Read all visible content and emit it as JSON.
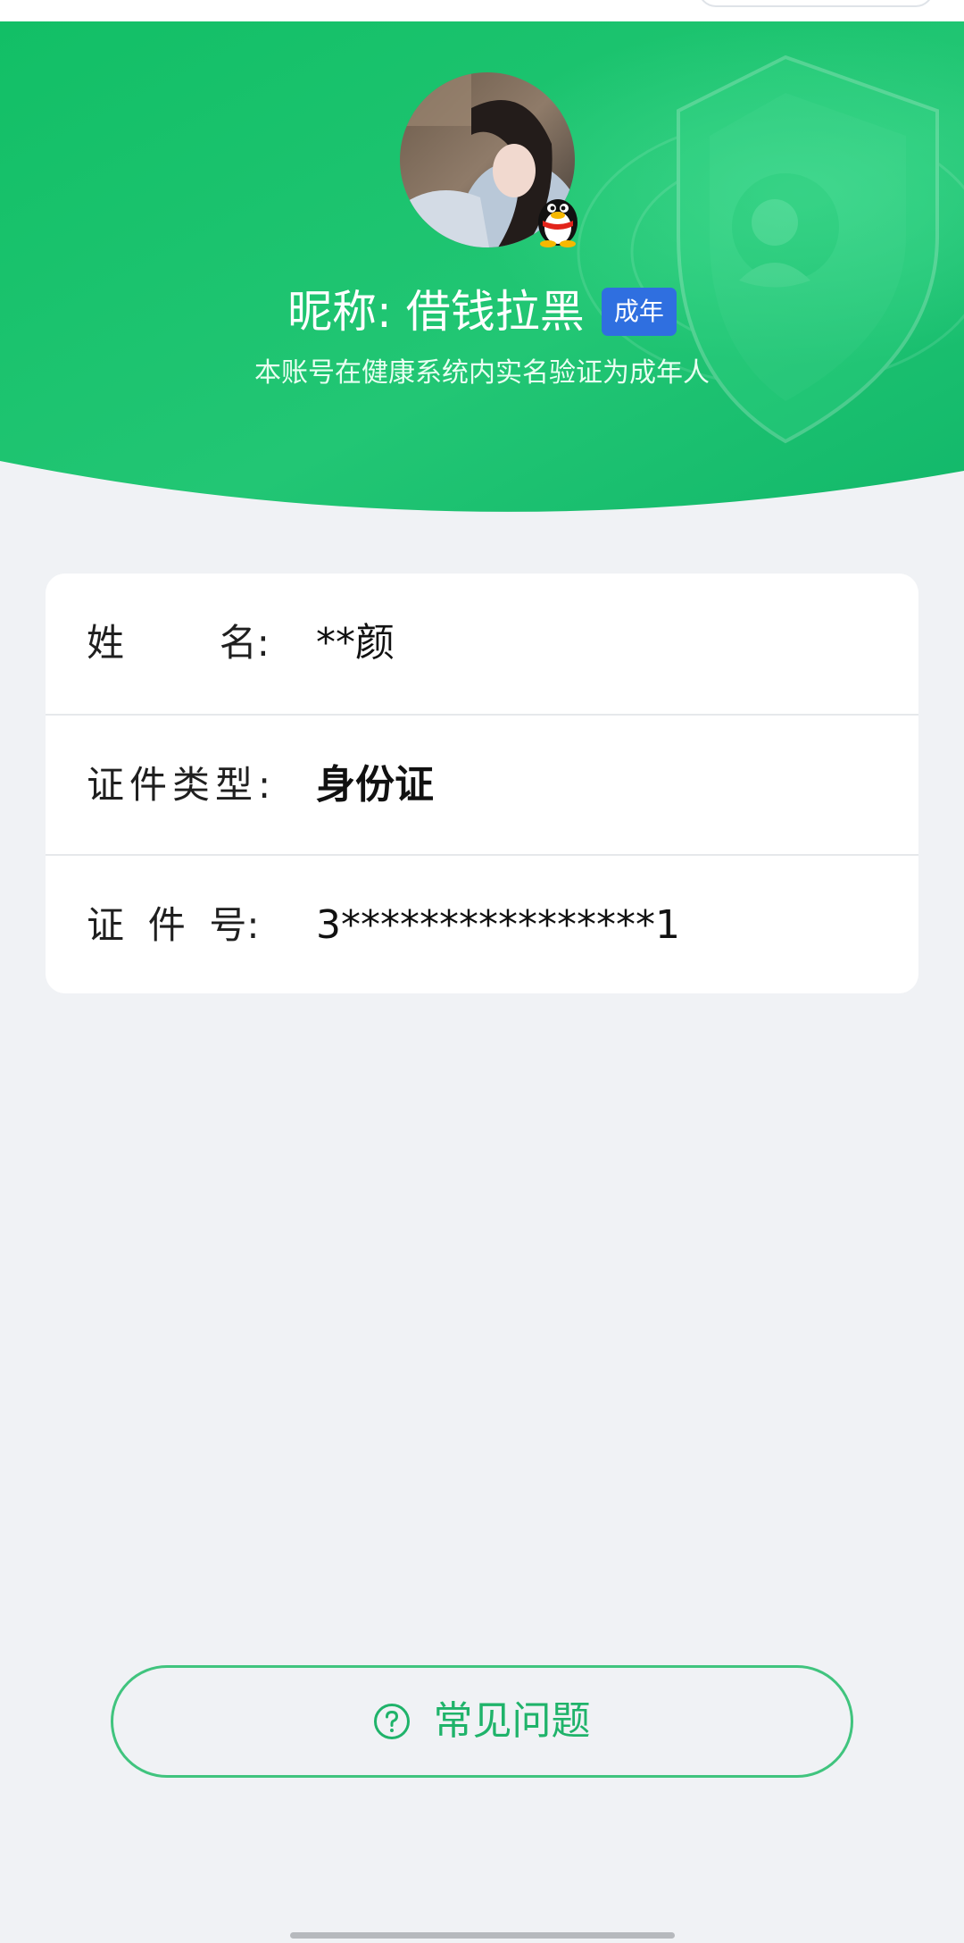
{
  "colors": {
    "header_green": "#16c06d",
    "accent_blue": "#2f6fe0",
    "faq_green": "#1fb36a",
    "page_background": "#f0f2f5"
  },
  "profile": {
    "nickname": "昵称: 借钱拉黑",
    "badge": "成年",
    "verification_text": "本账号在健康系统内实名验证为成年人",
    "avatar_icon": "user-photo-avatar",
    "platform_icon": "qq-penguin-icon"
  },
  "info": {
    "rows": [
      {
        "label": "姓        名:",
        "value": "**颜"
      },
      {
        "label": "证件类型:",
        "value": "身份证"
      },
      {
        "label": "证  件  号:",
        "value": "3****************1"
      }
    ]
  },
  "faq": {
    "label": "常见问题",
    "icon": "question-circle-icon"
  }
}
